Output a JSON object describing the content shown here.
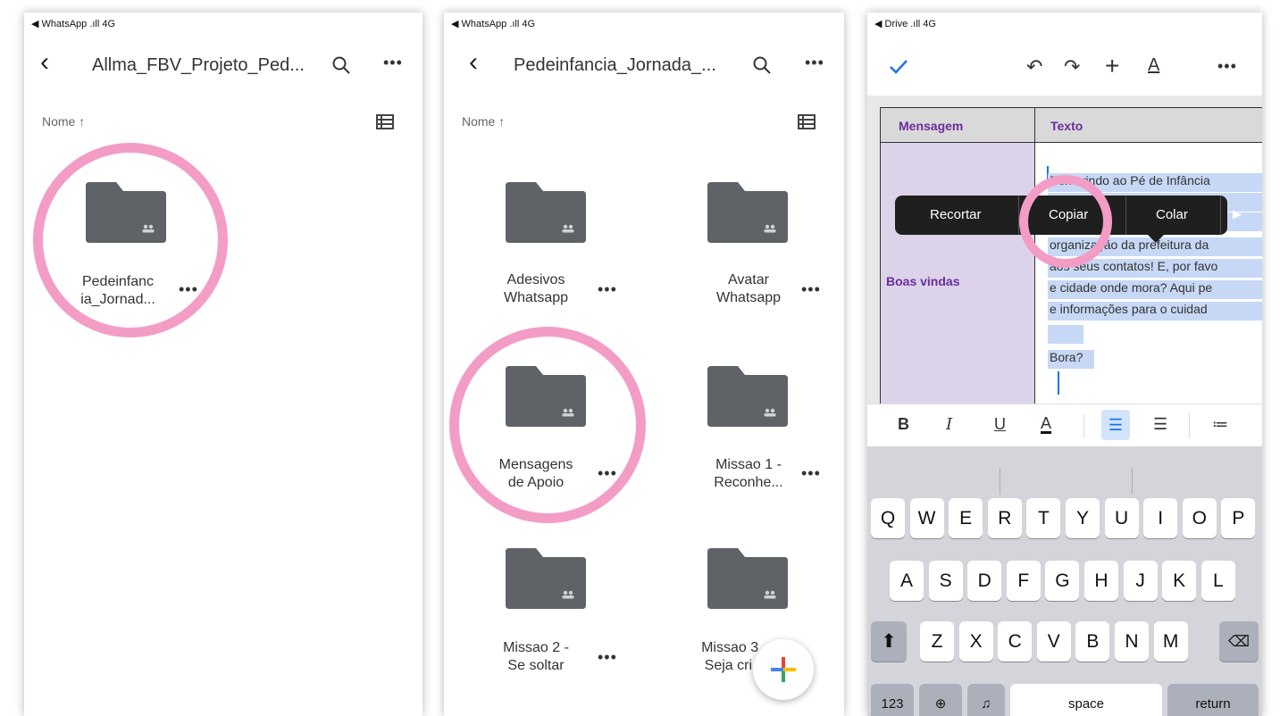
{
  "panel1": {
    "status": "◀ WhatsApp .ıll 4G",
    "title": "Allma_FBV_Projeto_Ped...",
    "sort_label": "Nome ↑",
    "folders": [
      {
        "line1": "Pedeinfanc",
        "line2": "ia_Jornad..."
      }
    ]
  },
  "panel2": {
    "status": "◀ WhatsApp .ıll 4G",
    "title": "Pedeinfancia_Jornada_...",
    "sort_label": "Nome ↑",
    "folders": [
      {
        "line1": "Adesivos",
        "line2": "Whatsapp"
      },
      {
        "line1": "Avatar",
        "line2": "Whatsapp"
      },
      {
        "line1": "Mensagens",
        "line2": "de Apoio"
      },
      {
        "line1": "Missao 1 -",
        "line2": "Reconhe..."
      },
      {
        "line1": "Missao 2 -",
        "line2": "Se soltar"
      },
      {
        "line1": "Missao 3 -",
        "line2": "Seja cri..."
      }
    ]
  },
  "panel3": {
    "status": "◀ Drive .ıll 4G",
    "table": {
      "col1_header": "Mensagem",
      "col2_header": "Texto",
      "row_label": "Boas vindas",
      "lines": [
        "Bem-vindo ao Pé de Infância",
        "",
        "",
        "organização da prefeitura da",
        "aos seus contatos! E, por favo",
        "e cidade onde mora? Aqui pe",
        "e informações para o cuidad",
        "",
        "Bora?"
      ]
    },
    "context_menu": [
      "Recortar",
      "Copiar",
      "Colar",
      "▶"
    ],
    "keyboard": {
      "row1": [
        "Q",
        "W",
        "E",
        "R",
        "T",
        "Y",
        "U",
        "I",
        "O",
        "P"
      ],
      "row2": [
        "A",
        "S",
        "D",
        "F",
        "G",
        "H",
        "J",
        "K",
        "L"
      ],
      "row3": [
        "Z",
        "X",
        "C",
        "V",
        "B",
        "N",
        "M"
      ],
      "num_key": "123",
      "space_key": "space",
      "return_key": "return"
    }
  },
  "colors": {
    "highlight_circle": "#f39cc6",
    "folder_gray": "#5f6368",
    "doc_purple_text": "#6a2c9e",
    "selection_blue": "#c6d8f5"
  }
}
